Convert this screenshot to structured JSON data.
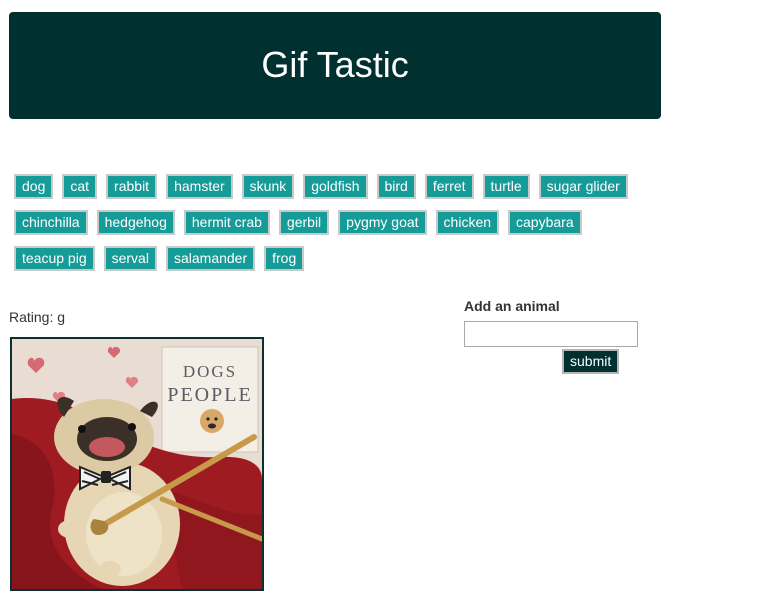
{
  "header": {
    "title": "Gif Tastic"
  },
  "animals": {
    "rows": [
      [
        "dog",
        "cat",
        "rabbit",
        "hamster",
        "skunk",
        "goldfish",
        "bird",
        "ferret",
        "turtle",
        "sugar glider"
      ],
      [
        "chinchilla",
        "hedgehog",
        "hermit crab",
        "gerbil",
        "pygmy goat",
        "chicken",
        "capybara"
      ],
      [
        "teacup pig",
        "serval",
        "salamander",
        "frog"
      ]
    ]
  },
  "results": {
    "rating_text": "Rating: g",
    "gif": {
      "book_title_top": "DOGS",
      "book_title_bottom": "PEOPLE"
    }
  },
  "form": {
    "label": "Add an animal",
    "input_value": "",
    "submit_label": "submit"
  },
  "colors": {
    "header_bg": "#013030",
    "button_bg": "#169c98",
    "submit_bg": "#013030"
  }
}
